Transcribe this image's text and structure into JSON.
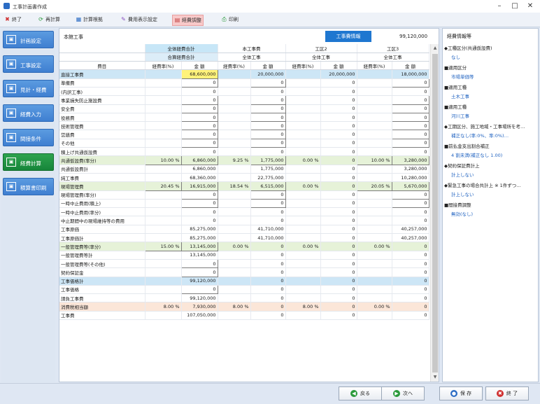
{
  "window": {
    "title": "工事計画書作成"
  },
  "toolbar": {
    "items": [
      {
        "label": "終了",
        "icon": "✖",
        "icon_name": "close-icon",
        "color": "#d03030"
      },
      {
        "label": "再計算",
        "icon": "⟳",
        "icon_name": "refresh-icon",
        "color": "#2a9a3a"
      },
      {
        "label": "計算根拠",
        "icon": "▦",
        "icon_name": "calc-basis-icon",
        "color": "#2b6cc4"
      },
      {
        "label": "費用表示設定",
        "icon": "✎",
        "icon_name": "settings-pen-icon",
        "color": "#8a4fc0"
      },
      {
        "label": "経費調整",
        "icon": "▤",
        "icon_name": "adjust-icon",
        "color": "#c04040"
      },
      {
        "label": "印刷",
        "icon": "⎙",
        "icon_name": "print-icon",
        "color": "#2a9a3a"
      }
    ]
  },
  "sidebar": {
    "items": [
      {
        "label": "計画設定",
        "icon": "▣"
      },
      {
        "label": "工事設定",
        "icon": "▣"
      },
      {
        "label": "見計・経費",
        "icon": "▣"
      },
      {
        "label": "経費入力",
        "icon": "▣"
      },
      {
        "label": "間接条件",
        "icon": "▣"
      },
      {
        "label": "経費計算",
        "icon": "▣"
      },
      {
        "label": "積算書印刷",
        "icon": "▣"
      }
    ]
  },
  "main": {
    "project": "本館工事",
    "kouji_button": "工事費情報",
    "amount": "99,120,000",
    "group_headers": [
      "全体経費合計",
      "本工事費",
      "工区2",
      "工区3"
    ],
    "sub_headers": [
      "合算経費合計",
      "全体工事",
      "全体工事",
      "全体工事"
    ],
    "col_headers": [
      "費目",
      "経費率(%)",
      "金 額",
      "経費率(%)",
      "金 額",
      "経費率(%)",
      "金 額",
      "経費率(%)",
      "金 額"
    ],
    "rows": [
      {
        "cls": "bl",
        "label": "直接工事費",
        "c": [
          "",
          "68,600,000",
          "",
          "20,000,000",
          "",
          "20,000,000",
          "",
          "18,000,000"
        ],
        "yel": [
          1
        ]
      },
      {
        "cls": "",
        "label": "準備費",
        "c": [
          "",
          "0",
          "",
          "0",
          "",
          "0",
          "",
          "0"
        ],
        "inp": [
          1,
          3,
          7
        ]
      },
      {
        "cls": "",
        "label": "(内訳工事)",
        "c": [
          "",
          "0",
          "",
          "0",
          "",
          "0",
          "",
          "0"
        ]
      },
      {
        "cls": "",
        "label": "事業損失防止施設費",
        "c": [
          "",
          "0",
          "",
          "0",
          "",
          "0",
          "",
          "0"
        ],
        "inp": [
          1,
          3,
          7
        ]
      },
      {
        "cls": "",
        "label": "安全費",
        "c": [
          "",
          "0",
          "",
          "0",
          "",
          "0",
          "",
          "0"
        ],
        "inp": [
          1,
          3,
          7
        ]
      },
      {
        "cls": "",
        "label": "役務費",
        "c": [
          "",
          "0",
          "",
          "0",
          "",
          "0",
          "",
          "0"
        ],
        "inp": [
          1,
          3,
          7
        ]
      },
      {
        "cls": "",
        "label": "技術管理費",
        "c": [
          "",
          "0",
          "",
          "0",
          "",
          "0",
          "",
          "0"
        ],
        "inp": [
          1,
          3,
          7
        ]
      },
      {
        "cls": "",
        "label": "営繕費",
        "c": [
          "",
          "0",
          "",
          "0",
          "",
          "0",
          "",
          "0"
        ],
        "inp": [
          1,
          3,
          7
        ]
      },
      {
        "cls": "",
        "label": "その他",
        "c": [
          "",
          "0",
          "",
          "0",
          "",
          "0",
          "",
          "0"
        ],
        "inp": [
          1,
          3,
          7
        ]
      },
      {
        "cls": "",
        "label": "積上げ共通仮設費",
        "c": [
          "",
          "0",
          "",
          "0",
          "",
          "0",
          "",
          "0"
        ]
      },
      {
        "cls": "gr",
        "label": "共通仮設費(率分)",
        "c": [
          "10.00 %",
          "6,860,000",
          "9.25 %",
          "1,775,000",
          "0.00 %",
          "0",
          "10.00 %",
          "3,280,000"
        ],
        "inp": [
          0,
          1,
          3,
          6,
          7
        ]
      },
      {
        "cls": "",
        "label": "共通仮設費計",
        "c": [
          "",
          "6,860,000",
          "",
          "1,775,000",
          "",
          "0",
          "",
          "3,280,000"
        ]
      },
      {
        "cls": "",
        "label": "純工事費",
        "c": [
          "",
          "68,360,000",
          "",
          "22,775,000",
          "",
          "0",
          "",
          "10,280,000"
        ]
      },
      {
        "cls": "gr",
        "label": "現場管理費",
        "c": [
          "20.45 %",
          "16,915,000",
          "18.54 %",
          "6,515,000",
          "0.00 %",
          "0",
          "20.05 %",
          "5,670,000"
        ],
        "inp": [
          0,
          1,
          3,
          6,
          7
        ]
      },
      {
        "cls": "",
        "label": "現場管理費(率分)",
        "c": [
          "",
          "0",
          "",
          "0",
          "",
          "0",
          "",
          "0"
        ],
        "inp": [
          1,
          3,
          7
        ]
      },
      {
        "cls": "",
        "label": "一時中止費用(積上)",
        "c": [
          "",
          "0",
          "",
          "0",
          "",
          "0",
          "",
          "0"
        ],
        "inp": [
          1,
          3,
          7
        ]
      },
      {
        "cls": "",
        "label": "一時中止費用(率分)",
        "c": [
          "",
          "0",
          "",
          "0",
          "",
          "0",
          "",
          "0"
        ]
      },
      {
        "cls": "",
        "label": "中止期間中の現場維持等の費用",
        "c": [
          "",
          "0",
          "",
          "0",
          "",
          "0",
          "",
          "0"
        ]
      },
      {
        "cls": "",
        "label": "工事原価",
        "c": [
          "",
          "85,275,000",
          "",
          "41,710,000",
          "",
          "0",
          "",
          "40,257,000"
        ]
      },
      {
        "cls": "",
        "label": "工事原価計",
        "c": [
          "",
          "85,275,000",
          "",
          "41,710,000",
          "",
          "0",
          "",
          "40,257,000"
        ]
      },
      {
        "cls": "gr",
        "label": "一般管理費等(率分)",
        "c": [
          "15.00 %",
          "13,145,000",
          "0.00 %",
          "0",
          "0.00 %",
          "0",
          "0.00 %",
          "0"
        ],
        "inp": [
          0,
          1
        ]
      },
      {
        "cls": "",
        "label": "一般管理費等計",
        "c": [
          "",
          "13,145,000",
          "",
          "0",
          "",
          "0",
          "",
          "0"
        ]
      },
      {
        "cls": "",
        "label": "一般管理費等(その他)",
        "c": [
          "",
          "0",
          "",
          "0",
          "",
          "0",
          "",
          "0"
        ],
        "inp": [
          1
        ]
      },
      {
        "cls": "",
        "label": "契約保証金",
        "c": [
          "",
          "0",
          "",
          "0",
          "",
          "0",
          "",
          "0"
        ],
        "inp": [
          1
        ]
      },
      {
        "cls": "bl",
        "label": "工事価格計",
        "c": [
          "",
          "99,120,000",
          "",
          "0",
          "",
          "0",
          "",
          "0"
        ],
        "yel": []
      },
      {
        "cls": "",
        "label": "工事価格",
        "c": [
          "",
          "0",
          "",
          "0",
          "",
          "0",
          "",
          "0"
        ],
        "inp": [
          1
        ]
      },
      {
        "cls": "",
        "label": "請負工事費",
        "c": [
          "",
          "99,120,000",
          "",
          "0",
          "",
          "0",
          "",
          "0"
        ]
      },
      {
        "cls": "pk",
        "label": "消費税相当額",
        "c": [
          "8.00 %",
          "7,930,000",
          "8.00 %",
          "0",
          "8.00 %",
          "0",
          "0.00 %",
          "0"
        ]
      },
      {
        "cls": "",
        "label": "工事費",
        "c": [
          "",
          "107,050,000",
          "",
          "0",
          "",
          "0",
          "",
          "0"
        ]
      }
    ]
  },
  "right": {
    "title": "経費情報等",
    "items": [
      {
        "k": "◆工種区分(共通仮設費)",
        "v": "なし"
      },
      {
        "k": "■適用区分",
        "v": "市場単価等"
      },
      {
        "k": "■適用工種",
        "v": "土木工事"
      },
      {
        "k": "■適用工種",
        "v": "河川工事"
      },
      {
        "k": "◆工期区分、施工地域・工事場所を考…",
        "v": "補正なし(率:0%、率:0%)…"
      },
      {
        "k": "■前払金支出割合補正",
        "v": "4 割未満(補正なし 1.00)"
      },
      {
        "k": "◆契約保証費計上",
        "v": "計上しない"
      },
      {
        "k": "◆緊急工事の場合共計上 ※ 1件ずつ…",
        "v": "計上しない"
      },
      {
        "k": "■間接費調整",
        "v": "無効(なし)"
      }
    ]
  },
  "footer": {
    "buttons": [
      {
        "label": "戻る",
        "icon": "◀",
        "color": "#2a9a3a"
      },
      {
        "label": "次へ",
        "icon": "▶",
        "color": "#2a9a3a"
      },
      {
        "label": "保 存",
        "icon": "●",
        "color": "#2b6cc4"
      },
      {
        "label": "終 了",
        "icon": "✖",
        "color": "#d03030"
      }
    ]
  }
}
